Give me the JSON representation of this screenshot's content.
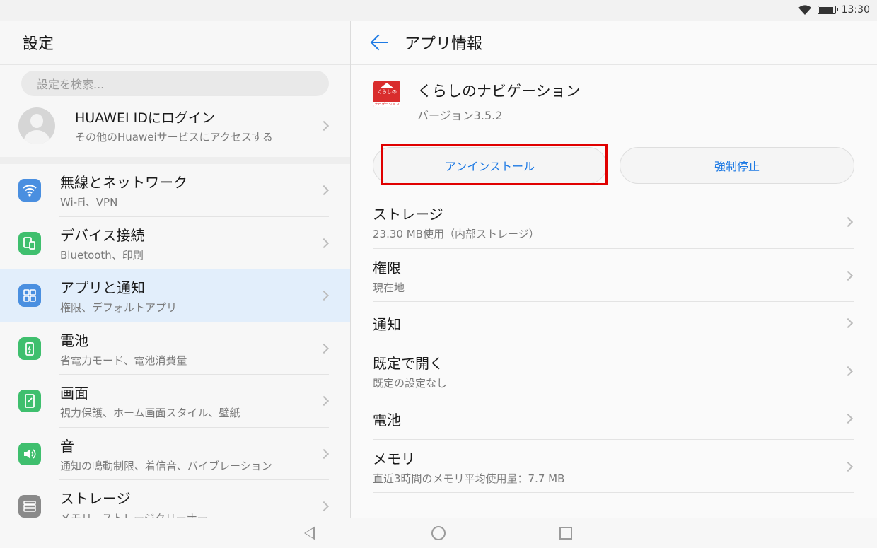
{
  "status_bar": {
    "time": "13:30"
  },
  "left_panel": {
    "title": "設定",
    "search_placeholder": "設定を検索...",
    "account": {
      "title": "HUAWEI IDにログイン",
      "subtitle": "その他のHuaweiサービスにアクセスする"
    },
    "items": [
      {
        "title": "無線とネットワーク",
        "subtitle": "Wi-Fi、VPN",
        "icon": "wifi-icon",
        "color": "#4a8fe0"
      },
      {
        "title": "デバイス接続",
        "subtitle": "Bluetooth、印刷",
        "icon": "device-connection-icon",
        "color": "#3fbf6e"
      },
      {
        "title": "アプリと通知",
        "subtitle": "権限、デフォルトアプリ",
        "icon": "apps-icon",
        "color": "#4a8fe0"
      },
      {
        "title": "電池",
        "subtitle": "省電力モード、電池消費量",
        "icon": "battery-icon",
        "color": "#3fbf6e"
      },
      {
        "title": "画面",
        "subtitle": "視力保護、ホーム画面スタイル、壁紙",
        "icon": "display-icon",
        "color": "#3fbf6e"
      },
      {
        "title": "音",
        "subtitle": "通知の鳴動制限、着信音、バイブレーション",
        "icon": "sound-icon",
        "color": "#3fbf6e"
      },
      {
        "title": "ストレージ",
        "subtitle": "メモリ、ストレージクリーナー",
        "icon": "storage-icon",
        "color": "#8a8a8a"
      }
    ],
    "active_index": 2
  },
  "right_panel": {
    "title": "アプリ情報",
    "app": {
      "name": "くらしのナビゲーション",
      "version": "バージョン3.5.2",
      "icon_text": "くらしの",
      "icon_sub": "ナビゲーション"
    },
    "buttons": {
      "uninstall": "アンインストール",
      "force_stop": "強制停止"
    },
    "rows": [
      {
        "title": "ストレージ",
        "subtitle": "23.30 MB使用（内部ストレージ）"
      },
      {
        "title": "権限",
        "subtitle": "現在地"
      },
      {
        "title": "通知",
        "subtitle": ""
      },
      {
        "title": "既定で開く",
        "subtitle": "既定の設定なし"
      },
      {
        "title": "電池",
        "subtitle": ""
      },
      {
        "title": "メモリ",
        "subtitle": "直近3時間のメモリ平均使用量：7.7 MB"
      }
    ]
  },
  "accent_color": "#1e7ae4",
  "highlight_color": "#e00000"
}
